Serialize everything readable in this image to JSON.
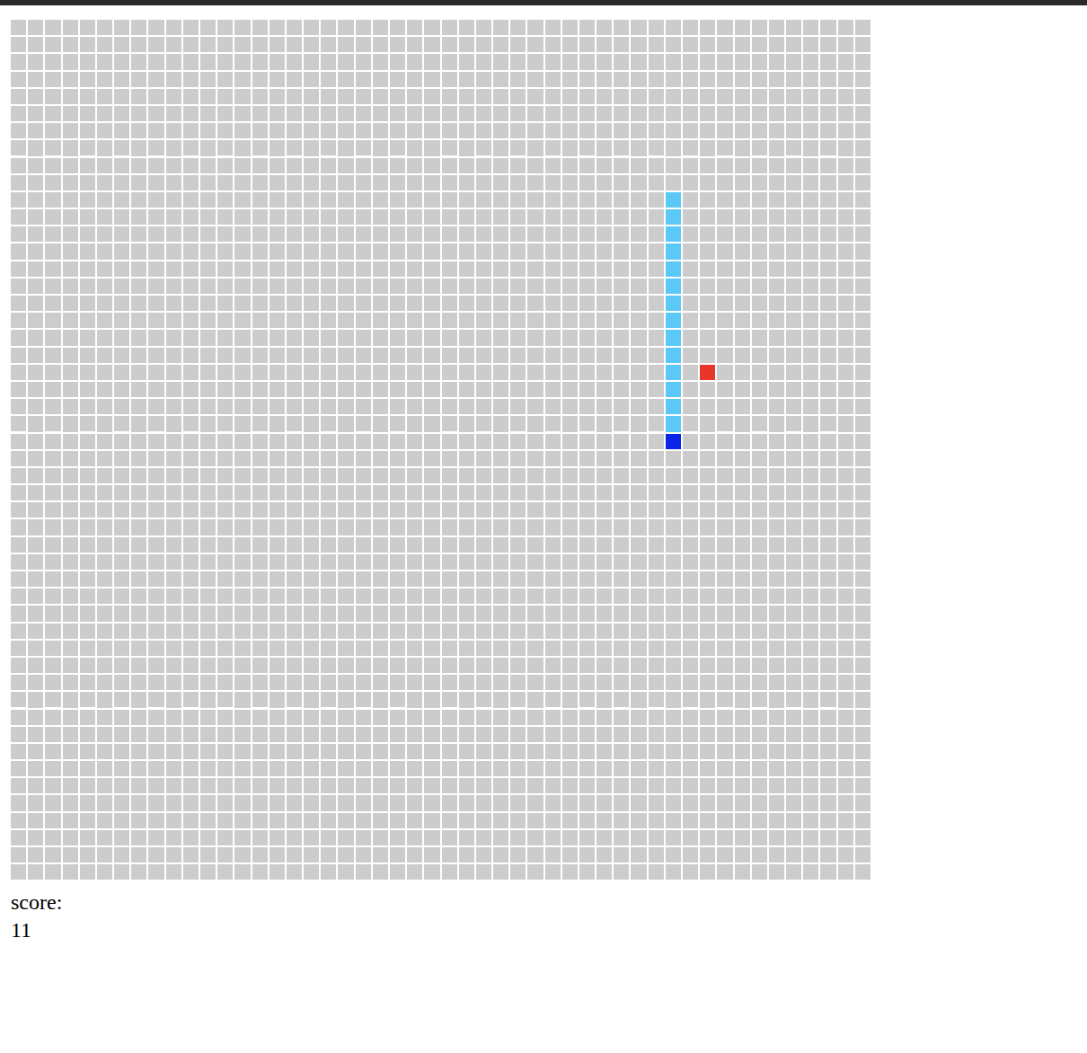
{
  "board": {
    "columns": 50,
    "rows": 50
  },
  "snake": [
    {
      "x": 38,
      "y": 10,
      "head": false
    },
    {
      "x": 38,
      "y": 11,
      "head": false
    },
    {
      "x": 38,
      "y": 12,
      "head": false
    },
    {
      "x": 38,
      "y": 13,
      "head": false
    },
    {
      "x": 38,
      "y": 14,
      "head": false
    },
    {
      "x": 38,
      "y": 15,
      "head": false
    },
    {
      "x": 38,
      "y": 16,
      "head": false
    },
    {
      "x": 38,
      "y": 17,
      "head": false
    },
    {
      "x": 38,
      "y": 18,
      "head": false
    },
    {
      "x": 38,
      "y": 19,
      "head": false
    },
    {
      "x": 38,
      "y": 20,
      "head": false
    },
    {
      "x": 38,
      "y": 21,
      "head": false
    },
    {
      "x": 38,
      "y": 22,
      "head": false
    },
    {
      "x": 38,
      "y": 23,
      "head": false
    },
    {
      "x": 38,
      "y": 24,
      "head": true
    }
  ],
  "food": {
    "x": 40,
    "y": 20
  },
  "score": {
    "label": "score:",
    "value": "11"
  }
}
